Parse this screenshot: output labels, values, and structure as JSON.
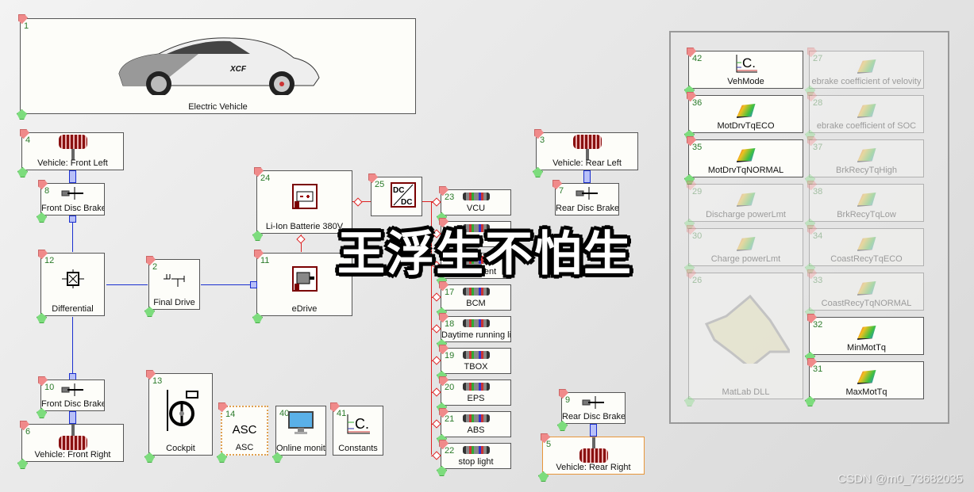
{
  "vehicle": {
    "num": "1",
    "label": "Electric Vehicle",
    "image": "car-image"
  },
  "blocks": {
    "front_left": {
      "num": "4",
      "label": "Vehicle: Front Left"
    },
    "front_brake_top": {
      "num": "8",
      "label": "Front Disc Brake"
    },
    "differential": {
      "num": "12",
      "label": "Differential"
    },
    "final_drive": {
      "num": "2",
      "label": "Final Drive"
    },
    "battery": {
      "num": "24",
      "label": "Li-Ion Batterie 380V"
    },
    "dcdc": {
      "num": "25",
      "label": "DC/DC"
    },
    "edrive": {
      "num": "11",
      "label": "eDrive"
    },
    "front_brake_bottom": {
      "num": "10",
      "label": "Front Disc Brake"
    },
    "front_right": {
      "num": "6",
      "label": "Vehicle: Front Right"
    },
    "cockpit": {
      "num": "13",
      "label": "Cockpit"
    },
    "asc": {
      "num": "14",
      "label": "ASC"
    },
    "online_monitor": {
      "num": "40",
      "label": "Online monito"
    },
    "constants": {
      "num": "41",
      "label": "Constants"
    },
    "rear_left": {
      "num": "3",
      "label": "Vehicle: Rear Left"
    },
    "rear_brake_top": {
      "num": "7",
      "label": "Rear Disc Brake"
    },
    "rear_brake_bottom": {
      "num": "9",
      "label": "Rear Disc Brake"
    },
    "rear_right": {
      "num": "5",
      "label": "Vehicle: Rear Right"
    }
  },
  "loads": [
    {
      "num": "23",
      "label": "VCU"
    },
    {
      "num": "",
      "label": ""
    },
    {
      "num": "",
      "label": "instrument"
    },
    {
      "num": "17",
      "label": "BCM"
    },
    {
      "num": "18",
      "label": "Daytime running lig"
    },
    {
      "num": "19",
      "label": "TBOX"
    },
    {
      "num": "20",
      "label": "EPS"
    },
    {
      "num": "21",
      "label": "ABS"
    },
    {
      "num": "22",
      "label": "stop light"
    }
  ],
  "group": {
    "left": [
      {
        "num": "42",
        "label": "VehMode",
        "active": true
      },
      {
        "num": "36",
        "label": "MotDrvTqECO",
        "active": true
      },
      {
        "num": "35",
        "label": "MotDrvTqNORMAL",
        "active": true
      },
      {
        "num": "29",
        "label": "Discharge powerLmt",
        "active": false
      },
      {
        "num": "30",
        "label": "Charge powerLmt",
        "active": false
      },
      {
        "num": "26",
        "label": "MatLab DLL",
        "active": false
      }
    ],
    "right": [
      {
        "num": "27",
        "label": "ebrake coefficient of velovity",
        "active": false
      },
      {
        "num": "28",
        "label": "ebrake coefficient of SOC",
        "active": false
      },
      {
        "num": "37",
        "label": "BrkRecyTqHigh",
        "active": false
      },
      {
        "num": "38",
        "label": "BrkRecyTqLow",
        "active": false
      },
      {
        "num": "34",
        "label": "CoastRecyTqECO",
        "active": false
      },
      {
        "num": "33",
        "label": "CoastRecyTqNORMAL",
        "active": false
      },
      {
        "num": "32",
        "label": "MinMotTq",
        "active": true
      },
      {
        "num": "31",
        "label": "MaxMotTq",
        "active": true
      }
    ]
  },
  "overlay_text": "王浮生不怕生",
  "watermark": "CSDN @m0_73682035"
}
